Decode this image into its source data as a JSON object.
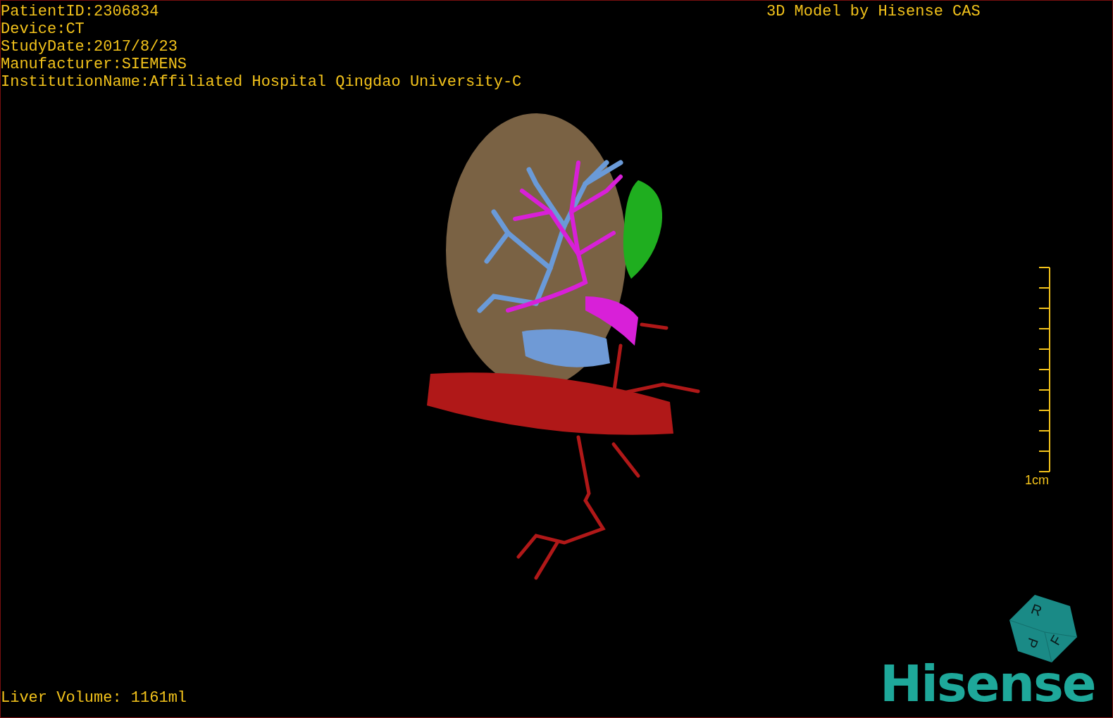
{
  "patient_info": [
    "PatientID:2306834",
    "Device:CT",
    "StudyDate:2017/8/23",
    "Manufacturer:SIEMENS",
    "InstitutionName:Affiliated Hospital Qingdao University-C"
  ],
  "title": "3D Model by Hisense CAS",
  "scale_bar": {
    "label": "1cm"
  },
  "orientation_cube": {
    "faces": [
      "R",
      "F",
      "P"
    ]
  },
  "logo": "Hisense",
  "liver_volume": "Liver Volume: 1161ml"
}
